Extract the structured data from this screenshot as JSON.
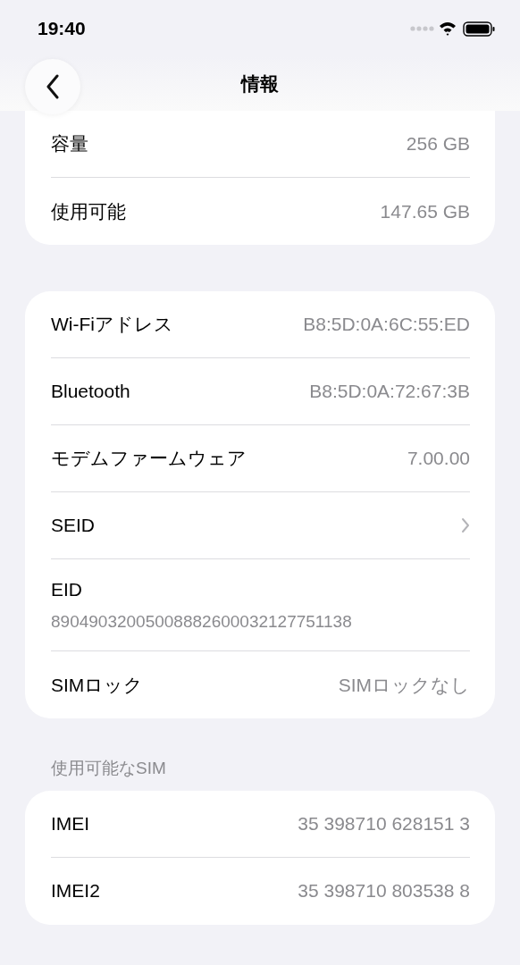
{
  "status_bar": {
    "time": "19:40"
  },
  "nav": {
    "title": "情報"
  },
  "groups": [
    {
      "top_cut": true,
      "rows": [
        {
          "kind": "value",
          "label": "容量",
          "value": "256 GB"
        },
        {
          "kind": "value",
          "label": "使用可能",
          "value": "147.65 GB"
        }
      ]
    },
    {
      "top_cut": false,
      "rows": [
        {
          "kind": "value",
          "label": "Wi-Fiアドレス",
          "value": "B8:5D:0A:6C:55:ED"
        },
        {
          "kind": "value",
          "label": "Bluetooth",
          "value": "B8:5D:0A:72:67:3B"
        },
        {
          "kind": "value",
          "label": "モデムファームウェア",
          "value": "7.00.00"
        },
        {
          "kind": "chevron",
          "label": "SEID"
        },
        {
          "kind": "stacked",
          "label": "EID",
          "value": "89049032005008882600032127751138"
        },
        {
          "kind": "value",
          "label": "SIMロック",
          "value": "SIMロックなし"
        }
      ]
    },
    {
      "header": "使用可能なSIM",
      "top_cut": false,
      "rows": [
        {
          "kind": "value",
          "label": "IMEI",
          "value": "35 398710 628151 3"
        },
        {
          "kind": "value",
          "label": "IMEI2",
          "value": "35 398710 803538 8"
        }
      ]
    }
  ]
}
